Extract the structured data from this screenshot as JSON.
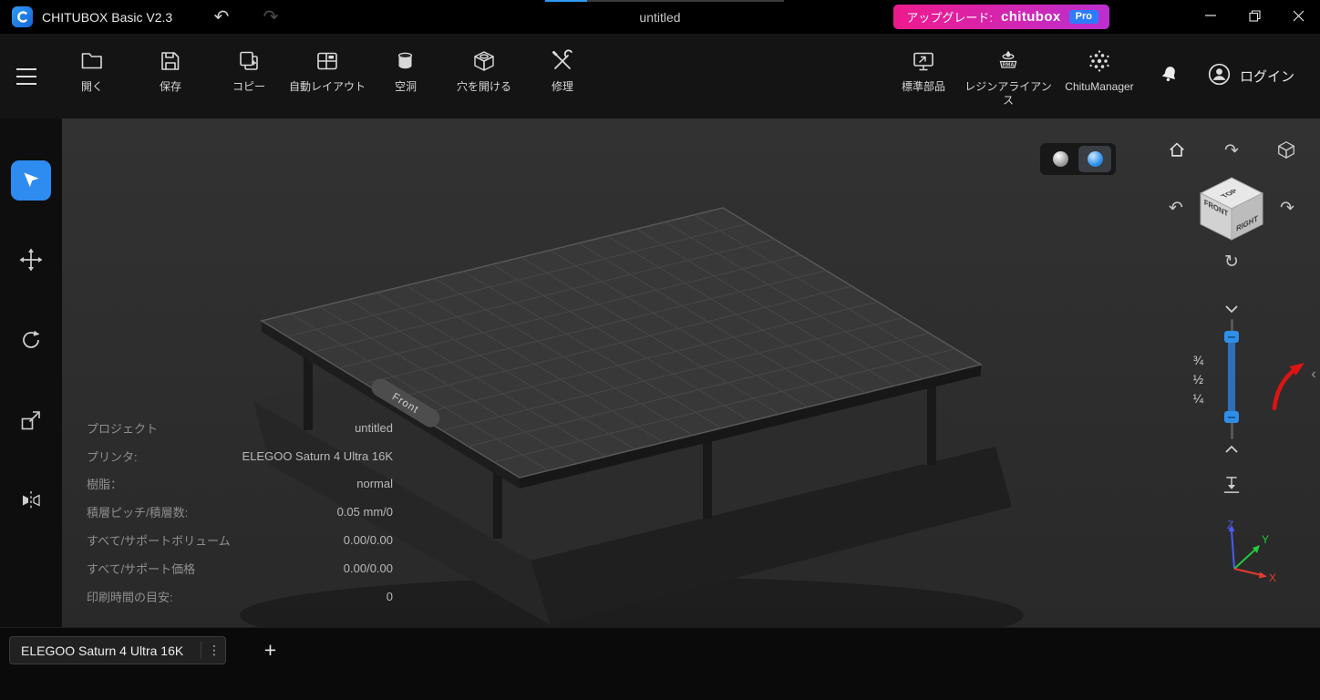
{
  "titlebar": {
    "app_title": "CHITUBOX Basic V2.3",
    "document_tab": "untitled",
    "upgrade": {
      "label": "アップグレード:",
      "brand": "chitubox",
      "badge": "Pro"
    }
  },
  "toolbar": {
    "items": [
      {
        "label": "開く"
      },
      {
        "label": "保存"
      },
      {
        "label": "コピー"
      },
      {
        "label": "自動レイアウト"
      },
      {
        "label": "空洞"
      },
      {
        "label": "穴を開ける"
      },
      {
        "label": "修理"
      }
    ],
    "right_items": [
      {
        "label": "標準部品"
      },
      {
        "label": "レジンアライアンス"
      },
      {
        "label": "ChituManager"
      }
    ],
    "login_label": "ログイン"
  },
  "viewport": {
    "plate_front_label": "Front",
    "view_cube": {
      "top": "TOP",
      "front": "FRONT",
      "right": "RIGHT"
    },
    "clip_fractions": [
      "¾",
      "½",
      "¼"
    ],
    "axes": {
      "x": "X",
      "y": "Y",
      "z": "Z"
    }
  },
  "info_panel": {
    "rows": [
      {
        "label": "プロジェクト",
        "value": "untitled"
      },
      {
        "label": "プリンタ:",
        "value": "ELEGOO Saturn 4 Ultra 16K"
      },
      {
        "label": "樹脂：",
        "value": "normal"
      },
      {
        "label": "積層ピッチ/積層数:",
        "value": "0.05 mm/0"
      },
      {
        "label": "すべて/サポートボリューム",
        "value": "0.00/0.00"
      },
      {
        "label": "すべて/サポート価格",
        "value": "0.00/0.00"
      },
      {
        "label": "印刷時間の目安:",
        "value": "0"
      }
    ]
  },
  "bottombar": {
    "printer_button": "ELEGOO Saturn 4 Ultra 16K",
    "add_label": "+"
  },
  "icons": {
    "undo": "↶",
    "redo": "↷",
    "orbit_up": "↷",
    "orbit_left": "↶",
    "orbit_right": "↷",
    "orbit_reset": "↻",
    "collapse": "‹",
    "kebab": "⋮"
  },
  "colors": {
    "accent_blue": "#2e8bf0",
    "upgrade_pink": "#ee1a8c",
    "axis_x": "#e8392f",
    "axis_y": "#22c93e",
    "axis_z": "#4a5bf0"
  }
}
